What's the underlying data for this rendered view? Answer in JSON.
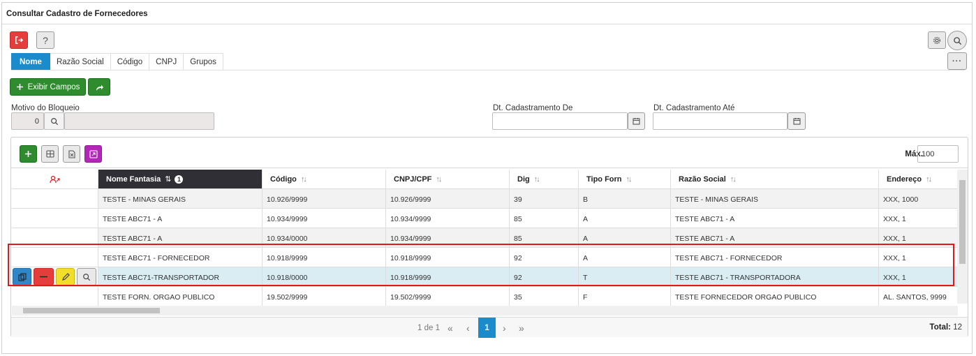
{
  "window": {
    "title": "Consultar Cadastro de Fornecedores"
  },
  "toolbar": {
    "exit_icon": "exit-icon",
    "help_label": "?",
    "settings_icon": "gear-icon",
    "search_icon": "search-icon",
    "more_label": "···"
  },
  "tabs": [
    {
      "label": "Nome",
      "active": true
    },
    {
      "label": "Razão Social"
    },
    {
      "label": "Código"
    },
    {
      "label": "CNPJ"
    },
    {
      "label": "Grupos"
    }
  ],
  "actions": {
    "show_fields_label": "Exibir Campos",
    "share_icon": "share-icon"
  },
  "filters": {
    "motivo_label": "Motivo do Bloqueio",
    "motivo_value": "0",
    "dt_de_label": "Dt. Cadastramento De",
    "dt_ate_label": "Dt. Cadastramento Até",
    "dt_de_value": "",
    "dt_ate_value": ""
  },
  "grid": {
    "max_label": "Máx.",
    "max_value": "100",
    "columns": [
      {
        "label": ""
      },
      {
        "label": "Nome Fantasia",
        "sort": "⇅",
        "sorted": true,
        "badge": "1"
      },
      {
        "label": "Código",
        "sort": "↑↓"
      },
      {
        "label": "CNPJ/CPF",
        "sort": "↑↓"
      },
      {
        "label": "Dig",
        "sort": "↑↓"
      },
      {
        "label": "Tipo Forn",
        "sort": "↑↓"
      },
      {
        "label": "Razão Social",
        "sort": "↑↓"
      },
      {
        "label": "Endereço",
        "sort": "↑↓"
      }
    ],
    "rows": [
      [
        "TESTE - MINAS GERAIS",
        "10.926/9999",
        "10.926/9999",
        "39",
        "B",
        "TESTE - MINAS GERAIS",
        "XXX, 1000"
      ],
      [
        "TESTE ABC71 - A",
        "10.934/9999",
        "10.934/9999",
        "85",
        "A",
        "TESTE ABC71 - A",
        "XXX, 1"
      ],
      [
        "TESTE ABC71 - A",
        "10.934/0000",
        "10.934/9999",
        "85",
        "A",
        "TESTE ABC71 - A",
        "XXX, 1"
      ],
      [
        "TESTE ABC71 - FORNECEDOR",
        "10.918/9999",
        "10.918/9999",
        "92",
        "A",
        "TESTE ABC71 - FORNECEDOR",
        "XXX, 1"
      ],
      [
        "TESTE ABC71-TRANSPORTADOR",
        "10.918/0000",
        "10.918/9999",
        "92",
        "T",
        "TESTE ABC71 - TRANSPORTADORA",
        "XXX, 1"
      ],
      [
        "TESTE FORN. ORGAO PUBLICO",
        "19.502/9999",
        "19.502/9999",
        "35",
        "F",
        "TESTE FORNECEDOR ORGAO PUBLICO",
        "AL. SANTOS, 9999"
      ]
    ],
    "selected_row": 4
  },
  "pager": {
    "info": "1 de 1",
    "first": "«",
    "prev": "‹",
    "current": "1",
    "next": "›",
    "last": "»",
    "total_label": "Total:",
    "total_value": "12"
  },
  "colors": {
    "accent": "#1a8ccc",
    "green": "#2e8b2e",
    "red": "#e53c3c",
    "purple": "#b227b8",
    "yellow": "#f2de2a",
    "highlight": "#e0181f"
  }
}
